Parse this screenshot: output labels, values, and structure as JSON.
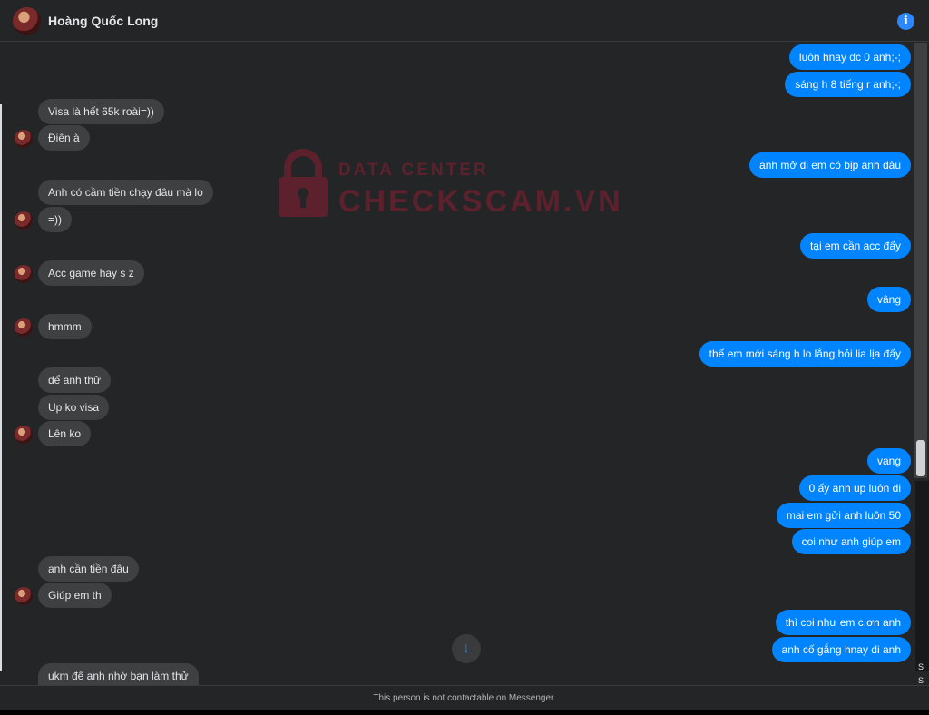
{
  "header": {
    "contact_name": "Hoàng Quốc Long",
    "info_icon": "i"
  },
  "watermark": {
    "line1": "DATA CENTER",
    "line2": "CHECKSCAM.VN"
  },
  "messages": {
    "out": [
      "luôn hnay dc 0 anh;-;",
      "sáng h 8 tiếng r anh;-;",
      "anh mở đi em có bịp anh đâu",
      "tại em cần acc đấy",
      "vâng",
      "thế em mới sáng h lo lắng hỏi lia lịa đấy",
      "vang",
      "0 ấy anh up luôn đi",
      "mai em gửi anh luôn 50",
      "coi như anh giúp em",
      "thì coi như em c.ơn anh",
      "anh cố gắng hnay di anh"
    ],
    "in": [
      "Visa là hết 65k roài=))",
      "Điên à",
      "Anh có cầm tiền chạy đâu mà lo",
      "=))",
      "Acc game hay s z",
      "hmmm",
      "để anh thử",
      "Up ko visa",
      "Lên ko",
      "anh cần tiền đâu",
      "Giúp em th",
      "ukm để anh nhờ bạn làm thử"
    ]
  },
  "scroll_down_icon": "↓",
  "footer": {
    "notice": "This person is not contactable on Messenger."
  },
  "side_panel": {
    "glyph1": "S",
    "glyph2": "S"
  }
}
